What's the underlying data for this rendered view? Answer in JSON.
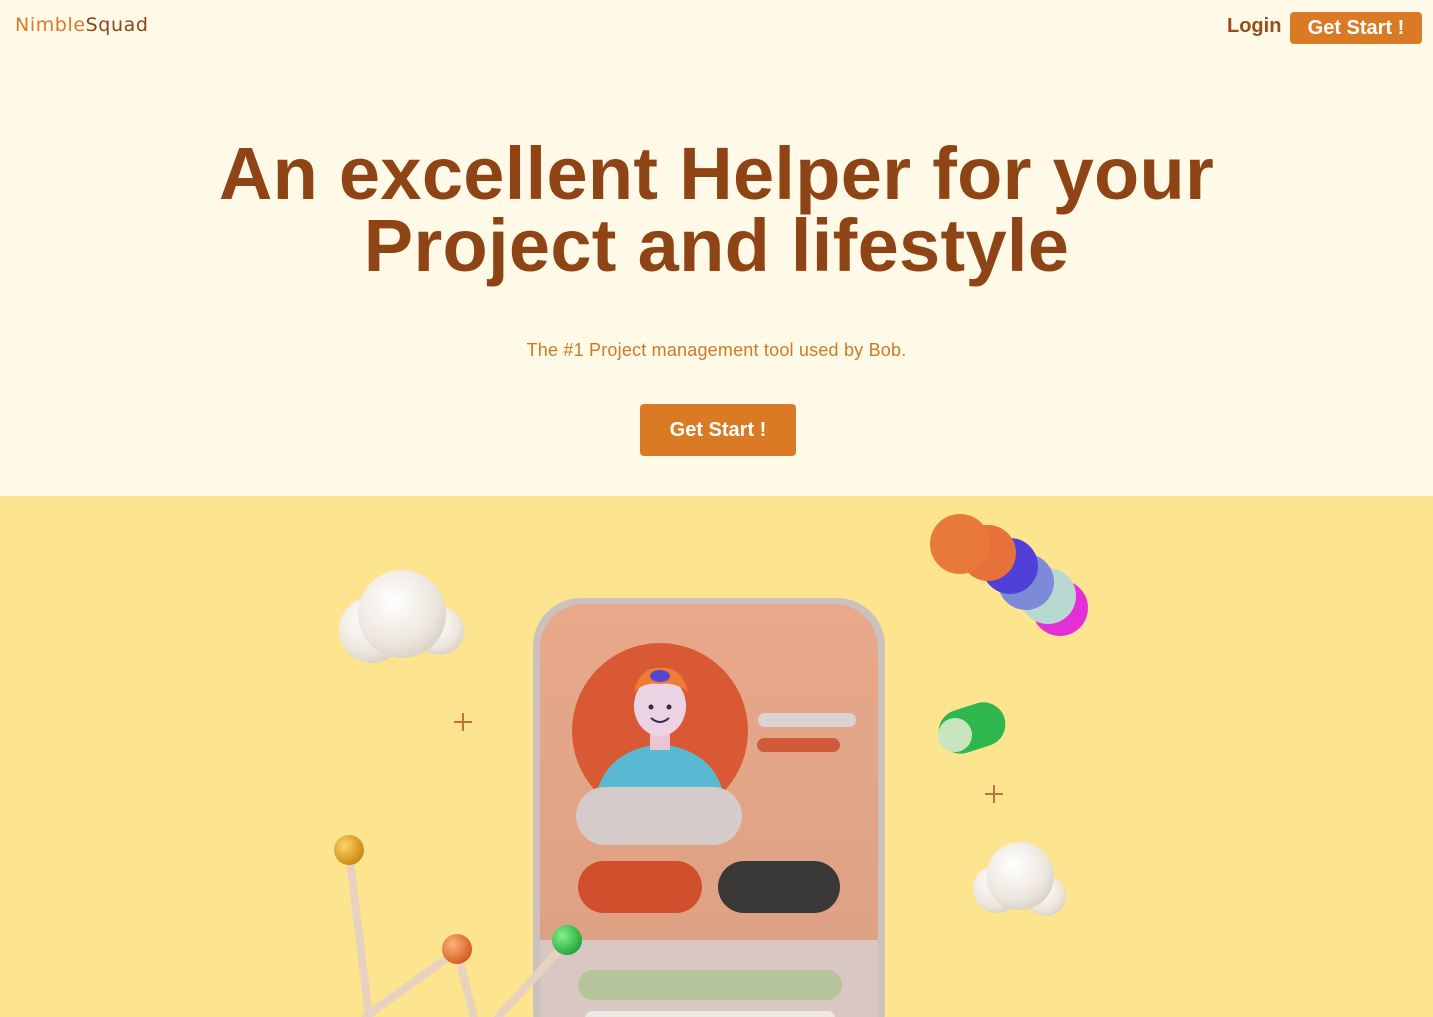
{
  "header": {
    "logo_part1": "Nimble",
    "logo_part2": "Squad",
    "login_label": "Login",
    "cta_label": "Get Start !"
  },
  "hero": {
    "headline_line1": "An excellent Helper for your",
    "headline_line2": "Project and lifestyle",
    "subheadline": "The #1 Project management tool used by Bob.",
    "cta_label": "Get Start !"
  },
  "colors": {
    "page_background": "#fffae8",
    "band_background": "#fde48f",
    "accent": "#db7a24",
    "headline": "#8f4416"
  }
}
